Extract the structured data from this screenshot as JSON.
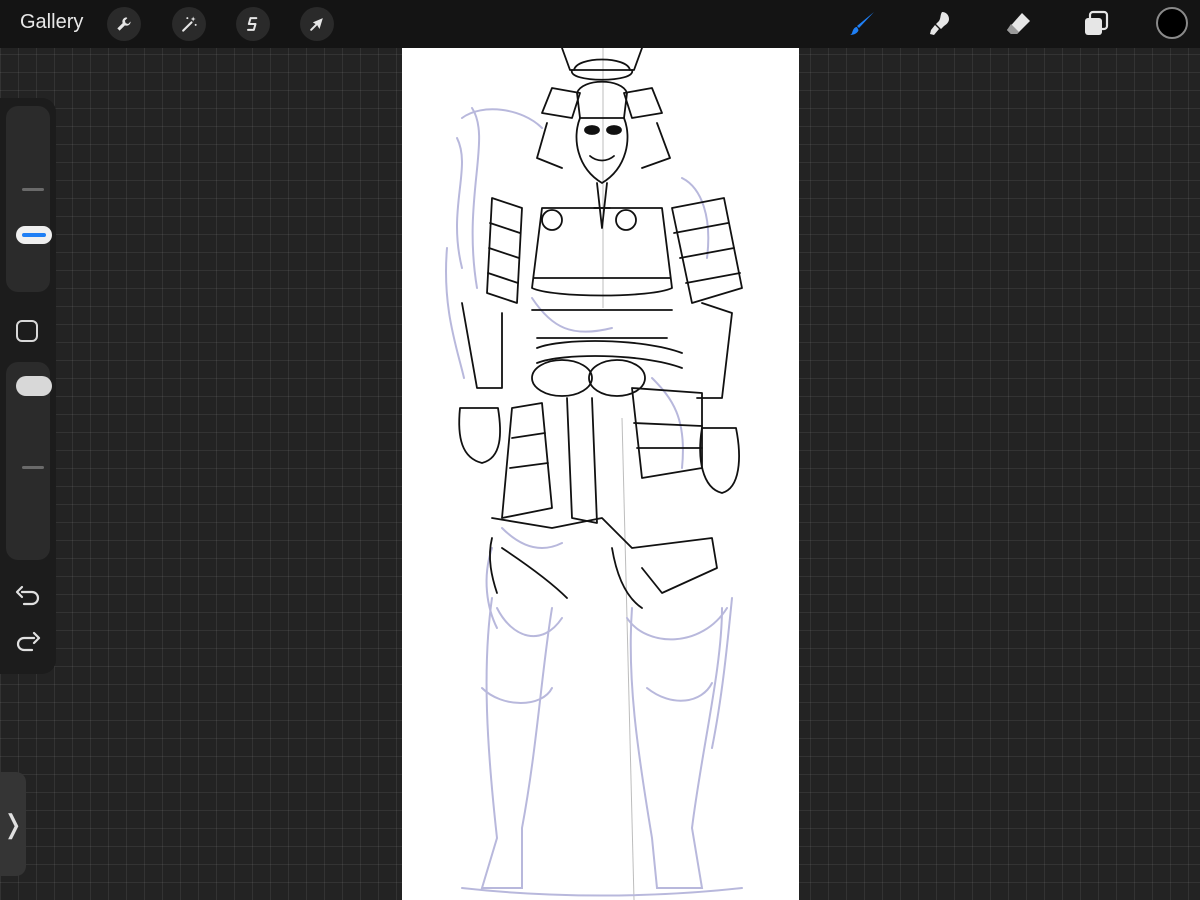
{
  "toolbar": {
    "gallery_label": "Gallery",
    "left_tools": [
      "wrench-icon",
      "magic-wand-icon",
      "selection-icon",
      "transform-arrow-icon"
    ],
    "right_tools": [
      "brush-icon",
      "smudge-icon",
      "eraser-icon",
      "layers-icon"
    ],
    "active_tool": "brush",
    "active_color": "#000000",
    "accent_color": "#1f7ff5"
  },
  "sidebar": {
    "brush_size_slider": "slider",
    "modify_button": "square-icon",
    "opacity_slider": "slider",
    "undo": "undo-icon",
    "redo": "redo-icon",
    "expand_tab_glyph": "❭"
  },
  "canvas": {
    "content": "samurai-armor-line-drawing",
    "sketch_color": "#b8b8dc",
    "ink_color": "#111111"
  }
}
